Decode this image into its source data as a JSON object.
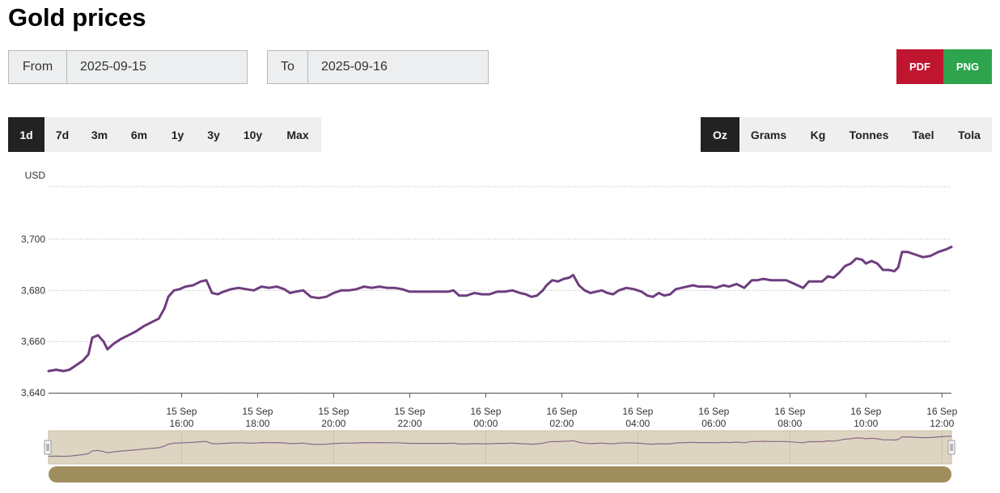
{
  "title": "Gold prices",
  "date_range": {
    "from_label": "From",
    "from_value": "2025-09-15",
    "to_label": "To",
    "to_value": "2025-09-16"
  },
  "export": {
    "pdf_label": "PDF",
    "png_label": "PNG",
    "pdf_color": "#c0152f",
    "png_color": "#2ea44f"
  },
  "periods": [
    {
      "label": "1d",
      "active": true
    },
    {
      "label": "7d",
      "active": false
    },
    {
      "label": "3m",
      "active": false
    },
    {
      "label": "6m",
      "active": false
    },
    {
      "label": "1y",
      "active": false
    },
    {
      "label": "3y",
      "active": false
    },
    {
      "label": "10y",
      "active": false
    },
    {
      "label": "Max",
      "active": false
    }
  ],
  "units": [
    {
      "label": "Oz",
      "active": true
    },
    {
      "label": "Grams",
      "active": false
    },
    {
      "label": "Kg",
      "active": false
    },
    {
      "label": "Tonnes",
      "active": false
    },
    {
      "label": "Tael",
      "active": false
    },
    {
      "label": "Tola",
      "active": false
    }
  ],
  "chart_data": {
    "type": "line",
    "ylabel": "USD",
    "ylim": [
      3640,
      3700
    ],
    "yticks": [
      3640,
      3660,
      3680,
      3700
    ],
    "ytick_labels": [
      "3,640",
      "3,660",
      "3,680",
      "3,700"
    ],
    "x_range_hours": [
      12.5,
      36.25
    ],
    "xticks": [
      {
        "hour": 16,
        "day": "15 Sep",
        "time": "16:00"
      },
      {
        "hour": 18,
        "day": "15 Sep",
        "time": "18:00"
      },
      {
        "hour": 20,
        "day": "15 Sep",
        "time": "20:00"
      },
      {
        "hour": 22,
        "day": "15 Sep",
        "time": "22:00"
      },
      {
        "hour": 24,
        "day": "16 Sep",
        "time": "00:00"
      },
      {
        "hour": 26,
        "day": "16 Sep",
        "time": "02:00"
      },
      {
        "hour": 28,
        "day": "16 Sep",
        "time": "04:00"
      },
      {
        "hour": 30,
        "day": "16 Sep",
        "time": "06:00"
      },
      {
        "hour": 32,
        "day": "16 Sep",
        "time": "08:00"
      },
      {
        "hour": 34,
        "day": "16 Sep",
        "time": "10:00"
      },
      {
        "hour": 36,
        "day": "16 Sep",
        "time": "12:00"
      }
    ],
    "series": [
      {
        "color": "#6e3d7f",
        "points": [
          [
            12.5,
            3648.5
          ],
          [
            12.7,
            3649
          ],
          [
            12.9,
            3648.5
          ],
          [
            13.05,
            3649
          ],
          [
            13.2,
            3650.5
          ],
          [
            13.4,
            3652.5
          ],
          [
            13.55,
            3655
          ],
          [
            13.65,
            3661.5
          ],
          [
            13.8,
            3662.5
          ],
          [
            13.95,
            3660
          ],
          [
            14.05,
            3657
          ],
          [
            14.2,
            3659
          ],
          [
            14.4,
            3661
          ],
          [
            14.6,
            3662.5
          ],
          [
            14.8,
            3664
          ],
          [
            15.0,
            3666
          ],
          [
            15.2,
            3667.5
          ],
          [
            15.4,
            3669
          ],
          [
            15.55,
            3673
          ],
          [
            15.65,
            3677.5
          ],
          [
            15.8,
            3680
          ],
          [
            15.95,
            3680.5
          ],
          [
            16.1,
            3681.5
          ],
          [
            16.3,
            3682
          ],
          [
            16.5,
            3683.5
          ],
          [
            16.65,
            3684
          ],
          [
            16.8,
            3679
          ],
          [
            16.95,
            3678.5
          ],
          [
            17.1,
            3679.5
          ],
          [
            17.3,
            3680.5
          ],
          [
            17.5,
            3681
          ],
          [
            17.7,
            3680.5
          ],
          [
            17.9,
            3680
          ],
          [
            18.1,
            3681.5
          ],
          [
            18.3,
            3681
          ],
          [
            18.5,
            3681.5
          ],
          [
            18.7,
            3680.5
          ],
          [
            18.85,
            3679
          ],
          [
            19.0,
            3679.5
          ],
          [
            19.2,
            3680
          ],
          [
            19.4,
            3677.5
          ],
          [
            19.6,
            3677
          ],
          [
            19.8,
            3677.5
          ],
          [
            20.0,
            3679
          ],
          [
            20.2,
            3680
          ],
          [
            20.4,
            3680
          ],
          [
            20.6,
            3680.5
          ],
          [
            20.8,
            3681.5
          ],
          [
            21.0,
            3681
          ],
          [
            21.2,
            3681.5
          ],
          [
            21.4,
            3681
          ],
          [
            21.6,
            3681
          ],
          [
            21.8,
            3680.5
          ],
          [
            22.0,
            3679.5
          ],
          [
            22.2,
            3679.5
          ],
          [
            22.5,
            3679.5
          ],
          [
            22.8,
            3679.5
          ],
          [
            23.0,
            3679.5
          ],
          [
            23.15,
            3680
          ],
          [
            23.3,
            3678
          ],
          [
            23.5,
            3678
          ],
          [
            23.7,
            3679
          ],
          [
            23.9,
            3678.5
          ],
          [
            24.1,
            3678.5
          ],
          [
            24.3,
            3679.5
          ],
          [
            24.5,
            3679.5
          ],
          [
            24.7,
            3680
          ],
          [
            24.9,
            3679
          ],
          [
            25.05,
            3678.5
          ],
          [
            25.2,
            3677.5
          ],
          [
            25.35,
            3678
          ],
          [
            25.5,
            3680
          ],
          [
            25.6,
            3682
          ],
          [
            25.75,
            3684
          ],
          [
            25.9,
            3683.5
          ],
          [
            26.05,
            3684.5
          ],
          [
            26.2,
            3685
          ],
          [
            26.3,
            3686
          ],
          [
            26.45,
            3682
          ],
          [
            26.6,
            3680
          ],
          [
            26.75,
            3679
          ],
          [
            26.9,
            3679.5
          ],
          [
            27.05,
            3680
          ],
          [
            27.2,
            3679
          ],
          [
            27.35,
            3678.5
          ],
          [
            27.5,
            3680
          ],
          [
            27.7,
            3681
          ],
          [
            27.9,
            3680.5
          ],
          [
            28.1,
            3679.5
          ],
          [
            28.25,
            3678
          ],
          [
            28.4,
            3677.5
          ],
          [
            28.55,
            3679
          ],
          [
            28.7,
            3678
          ],
          [
            28.85,
            3678.5
          ],
          [
            29.0,
            3680.5
          ],
          [
            29.15,
            3681
          ],
          [
            29.3,
            3681.5
          ],
          [
            29.45,
            3682
          ],
          [
            29.6,
            3681.5
          ],
          [
            29.75,
            3681.5
          ],
          [
            29.9,
            3681.5
          ],
          [
            30.05,
            3681
          ],
          [
            30.25,
            3682
          ],
          [
            30.4,
            3681.5
          ],
          [
            30.6,
            3682.5
          ],
          [
            30.8,
            3681
          ],
          [
            31.0,
            3684
          ],
          [
            31.15,
            3684
          ],
          [
            31.3,
            3684.5
          ],
          [
            31.5,
            3684
          ],
          [
            31.7,
            3684
          ],
          [
            31.9,
            3684
          ],
          [
            32.05,
            3683
          ],
          [
            32.2,
            3682
          ],
          [
            32.35,
            3681
          ],
          [
            32.5,
            3683.5
          ],
          [
            32.7,
            3683.5
          ],
          [
            32.85,
            3683.5
          ],
          [
            33.0,
            3685.5
          ],
          [
            33.15,
            3685
          ],
          [
            33.3,
            3687
          ],
          [
            33.45,
            3689.5
          ],
          [
            33.6,
            3690.5
          ],
          [
            33.75,
            3692.5
          ],
          [
            33.9,
            3692
          ],
          [
            34.0,
            3690.5
          ],
          [
            34.15,
            3691.5
          ],
          [
            34.3,
            3690.5
          ],
          [
            34.45,
            3688
          ],
          [
            34.6,
            3688
          ],
          [
            34.75,
            3687.5
          ],
          [
            34.85,
            3689
          ],
          [
            34.95,
            3695
          ],
          [
            35.1,
            3695
          ],
          [
            35.3,
            3694
          ],
          [
            35.5,
            3693
          ],
          [
            35.7,
            3693.5
          ],
          [
            35.9,
            3695
          ],
          [
            36.1,
            3696
          ],
          [
            36.25,
            3697
          ]
        ]
      }
    ],
    "grid": "horizontal dotted",
    "navigator": true
  }
}
